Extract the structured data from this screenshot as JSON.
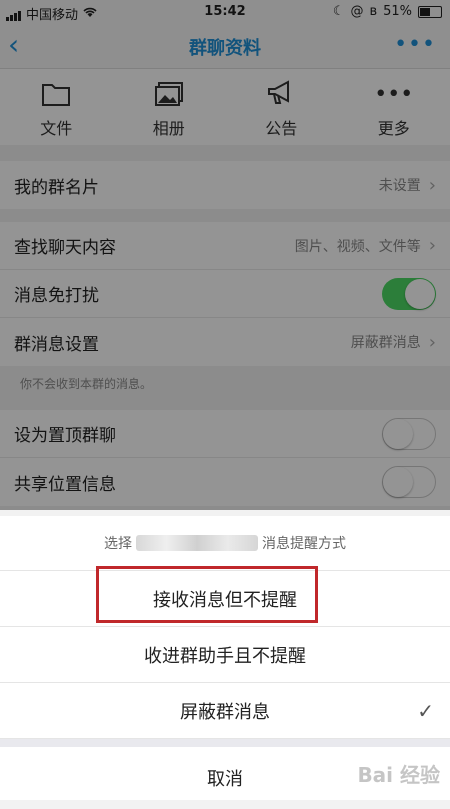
{
  "status": {
    "carrier": "中国移动",
    "time": "15:42",
    "battery": "51%",
    "battery_level": 0.51
  },
  "nav": {
    "title": "群聊资料"
  },
  "toolbar": [
    {
      "label": "文件",
      "icon": "folder-icon"
    },
    {
      "label": "相册",
      "icon": "album-icon"
    },
    {
      "label": "公告",
      "icon": "megaphone-icon"
    },
    {
      "label": "更多",
      "icon": "more-icon"
    }
  ],
  "settings": {
    "group_card": {
      "label": "我的群名片",
      "value": "未设置"
    },
    "search": {
      "label": "查找聊天内容",
      "value": "图片、视频、文件等"
    },
    "dnd": {
      "label": "消息免打扰",
      "on": true
    },
    "msg_setting": {
      "label": "群消息设置",
      "value": "屏蔽群消息"
    },
    "hint": "你不会收到本群的消息。",
    "pin": {
      "label": "设为置顶群聊",
      "on": false
    },
    "location": {
      "label": "共享位置信息",
      "on": false
    }
  },
  "sheet": {
    "title_prefix": "选择",
    "title_suffix": "消息提醒方式",
    "options": [
      {
        "label": "接收消息但不提醒",
        "selected": false
      },
      {
        "label": "收进群助手且不提醒",
        "selected": false
      },
      {
        "label": "屏蔽群消息",
        "selected": true
      }
    ],
    "cancel": "取消"
  },
  "watermark": "Bai 经验",
  "colors": {
    "accent": "#1f8fd6",
    "toggle_on": "#4cd964",
    "highlight": "#c0282b"
  }
}
